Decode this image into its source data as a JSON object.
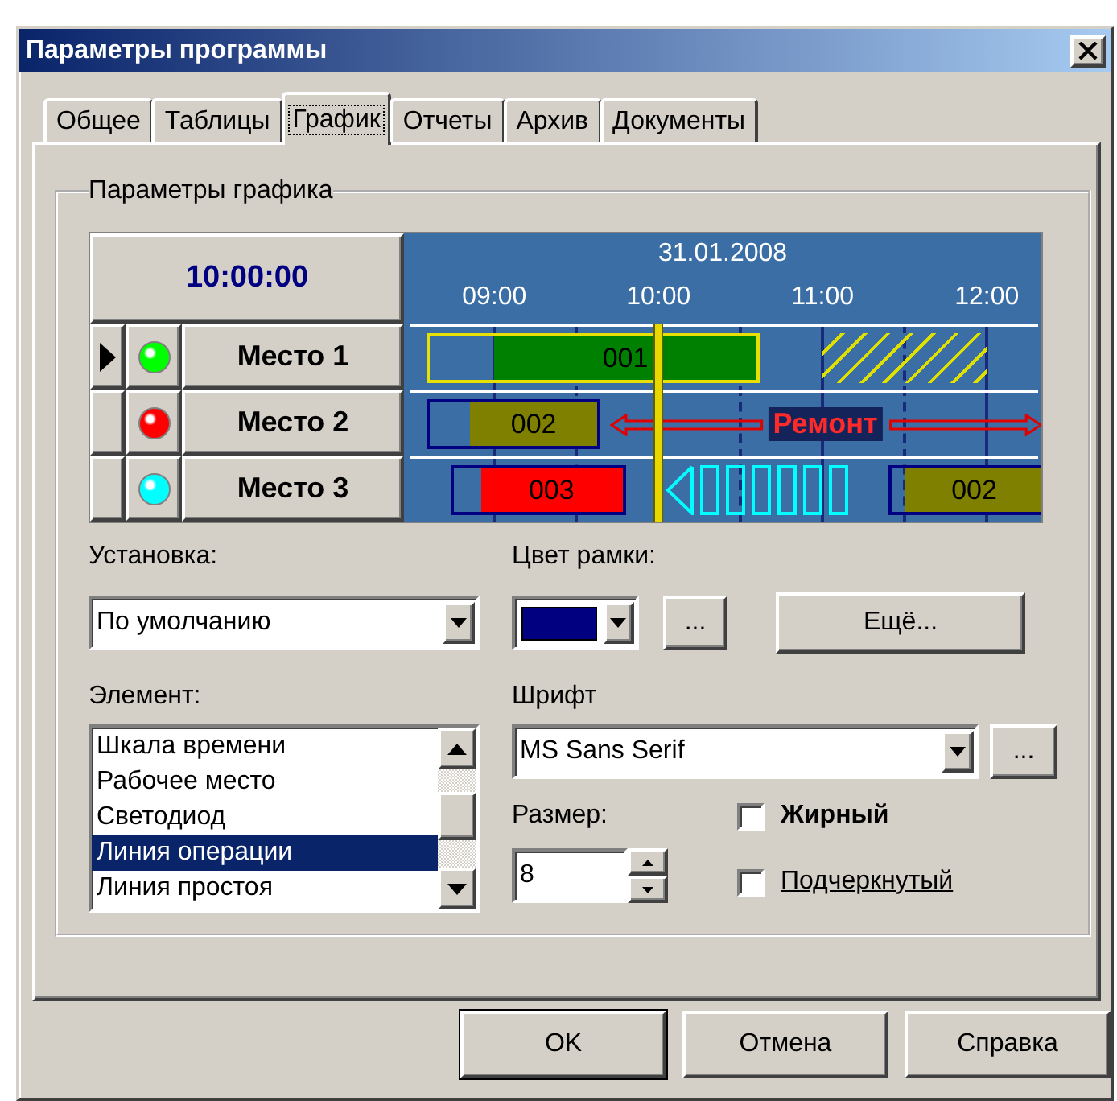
{
  "window": {
    "title": "Параметры программы"
  },
  "tabs": [
    {
      "label": "Общее",
      "selected": false
    },
    {
      "label": "Таблицы",
      "selected": false
    },
    {
      "label": "График",
      "selected": true
    },
    {
      "label": "Отчеты",
      "selected": false
    },
    {
      "label": "Архив",
      "selected": false
    },
    {
      "label": "Документы",
      "selected": false
    }
  ],
  "group": {
    "title": "Параметры графика"
  },
  "schedule": {
    "current_time": "10:00:00",
    "date": "31.01.2008",
    "ticks": [
      "09:00",
      "10:00",
      "11:00",
      "12:00"
    ],
    "rows": [
      {
        "name": "Место 1",
        "color": "#00ff00",
        "selected": true,
        "items": [
          {
            "kind": "operation",
            "label": "001",
            "color": "#008000",
            "highlighted": true
          },
          {
            "kind": "hatch"
          }
        ]
      },
      {
        "name": "Место 2",
        "color": "#ff0000",
        "selected": false,
        "items": [
          {
            "kind": "operation",
            "label": "002",
            "color": "#808000",
            "highlighted": false
          },
          {
            "kind": "repair",
            "label": "Ремонт"
          }
        ]
      },
      {
        "name": "Место 3",
        "color": "#00ffff",
        "selected": false,
        "items": [
          {
            "kind": "operation",
            "label": "003",
            "color": "#ff0000",
            "highlighted": false
          },
          {
            "kind": "changeover"
          },
          {
            "kind": "operation",
            "label": "002",
            "color": "#808000",
            "highlighted": false
          }
        ]
      }
    ]
  },
  "preset": {
    "label": "Установка:",
    "value": "По умолчанию"
  },
  "frame_color": {
    "label": "Цвет рамки:",
    "color": "#000080",
    "browse": "..."
  },
  "more_button": "Ещё...",
  "element": {
    "label": "Элемент:",
    "items": [
      {
        "label": "Шкала времени",
        "selected": false
      },
      {
        "label": "Рабочее место",
        "selected": false
      },
      {
        "label": "Светодиод",
        "selected": false
      },
      {
        "label": "Линия операции",
        "selected": true
      },
      {
        "label": "Линия простоя",
        "selected": false
      }
    ]
  },
  "font": {
    "label": "Шрифт",
    "value": "MS Sans Serif",
    "browse": "..."
  },
  "size": {
    "label": "Размер:",
    "value": "8"
  },
  "options": [
    {
      "kind": "bold",
      "label": "Жирный",
      "checked": false
    },
    {
      "kind": "underline",
      "label": "Подчеркнутый",
      "checked": false
    }
  ],
  "buttons": [
    {
      "label": "OK",
      "default": true
    },
    {
      "label": "Отмена",
      "default": false
    },
    {
      "label": "Справка",
      "default": false
    }
  ]
}
